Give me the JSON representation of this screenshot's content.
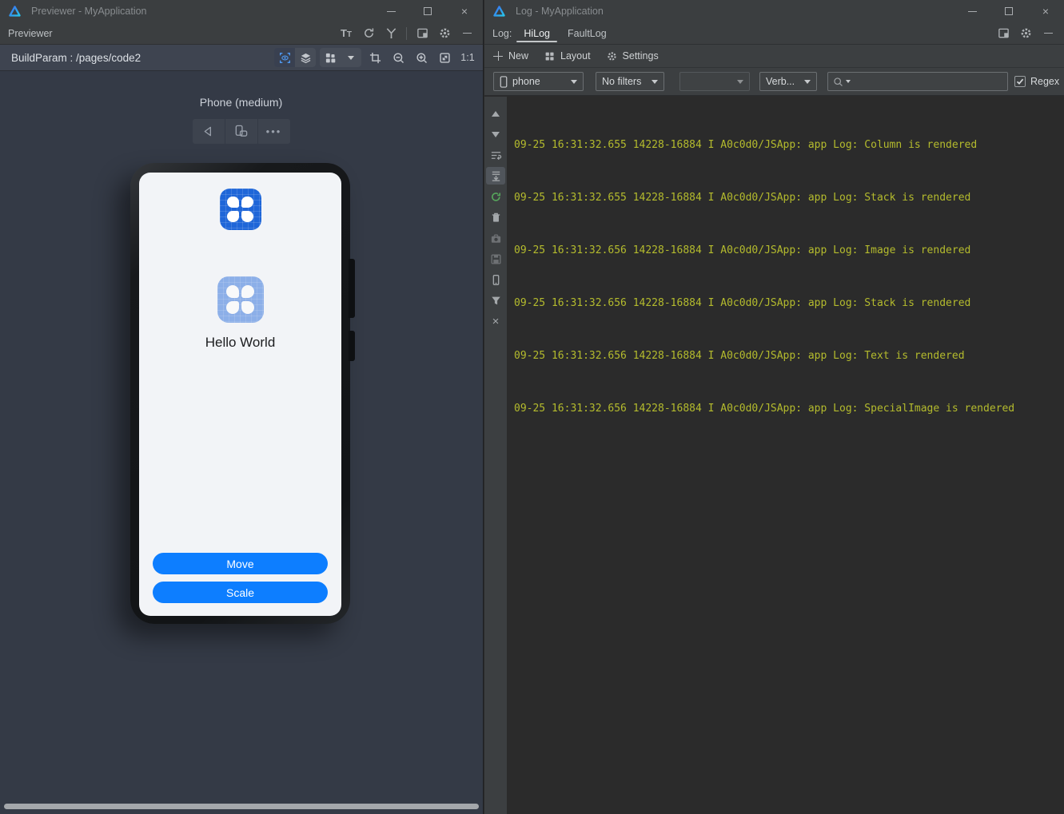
{
  "previewer": {
    "window_title": "Previewer - MyApplication",
    "tab_label": "Previewer",
    "build_param": "BuildParam : /pages/code2",
    "zoom_ratio_label": "1:1",
    "device_label": "Phone (medium)",
    "screen": {
      "hello_text": "Hello World",
      "move_label": "Move",
      "scale_label": "Scale"
    }
  },
  "log_window": {
    "window_title": "Log - MyApplication",
    "log_prefix": "Log:",
    "tabs": [
      {
        "label": "HiLog",
        "active": true
      },
      {
        "label": "FaultLog",
        "active": false
      }
    ],
    "toolbar": {
      "new_label": "New",
      "layout_label": "Layout",
      "settings_label": "Settings"
    },
    "filters": {
      "device_value": "phone",
      "filter_value": "No filters",
      "extra_value": "",
      "level_value": "Verb...",
      "search_value": "",
      "search_placeholder": "",
      "regex_label": "Regex",
      "regex_checked": true
    },
    "lines": [
      "09-25 16:31:32.655 14228-16884 I A0c0d0/JSApp: app Log: Column is rendered",
      "09-25 16:31:32.655 14228-16884 I A0c0d0/JSApp: app Log: Stack is rendered",
      "09-25 16:31:32.656 14228-16884 I A0c0d0/JSApp: app Log: Image is rendered",
      "09-25 16:31:32.656 14228-16884 I A0c0d0/JSApp: app Log: Stack is rendered",
      "09-25 16:31:32.656 14228-16884 I A0c0d0/JSApp: app Log: Text is rendered",
      "09-25 16:31:32.656 14228-16884 I A0c0d0/JSApp: app Log: SpecialImage is rendered"
    ]
  },
  "colors": {
    "accent_blue": "#0d7eff",
    "app_icon_blue": "#1f66d8",
    "log_text": "#b4bb2d",
    "panel_bg": "#343a46",
    "chrome_bg": "#3b3e40",
    "editor_bg": "#2b2b2b"
  }
}
